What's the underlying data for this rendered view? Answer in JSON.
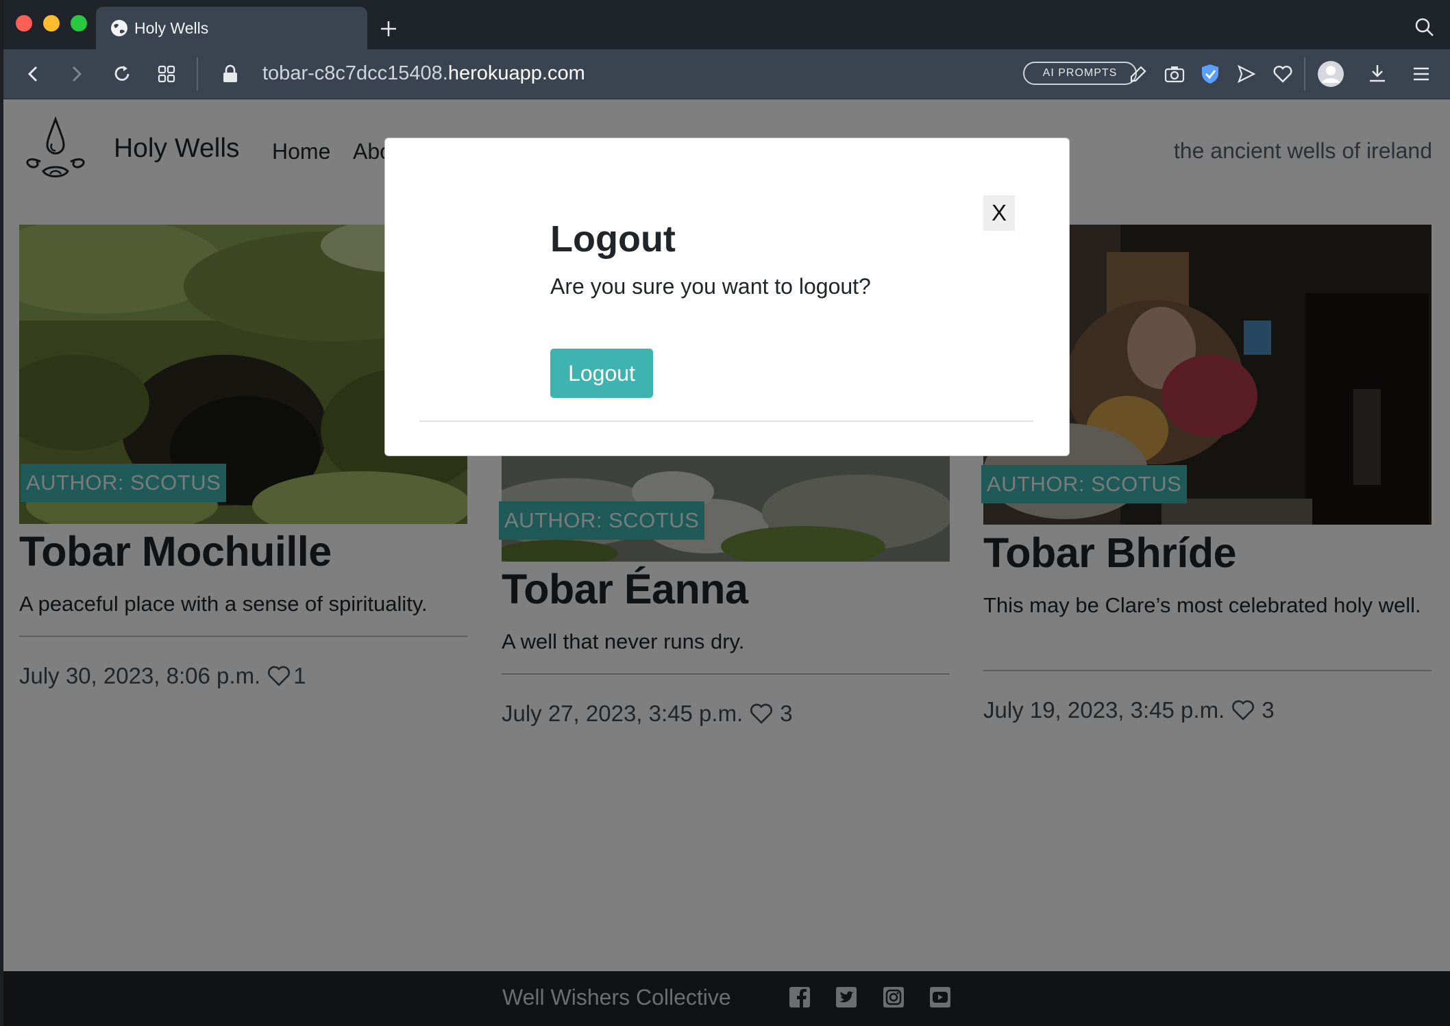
{
  "browser": {
    "tab_title": "Holy Wells",
    "url_prefix": "tobar-c8c7dcc15408.",
    "url_host": "herokuapp.com",
    "ai_prompts_label": "AI PROMPTS"
  },
  "site": {
    "brand": "Holy Wells",
    "nav": {
      "home": "Home",
      "about_partial": "Abo"
    },
    "tagline": "the ancient wells of ireland"
  },
  "cards": [
    {
      "author": "AUTHOR: SCOTUS",
      "title": "Tobar Mochuille",
      "excerpt": "A peaceful place with a sense of spirituality.",
      "date": "July 30, 2023, 8:06 p.m.",
      "likes": "1"
    },
    {
      "author": "AUTHOR: SCOTUS",
      "title": "Tobar Éanna",
      "excerpt": "A well that never runs dry.",
      "date": "July 27, 2023, 3:45 p.m.",
      "likes": "3"
    },
    {
      "author": "AUTHOR: SCOTUS",
      "title": "Tobar Bhríde",
      "excerpt": "This may be Clare’s most celebrated holy well.",
      "date": "July 19, 2023, 3:45 p.m.",
      "likes": "3"
    }
  ],
  "footer": {
    "text": "Well Wishers Collective"
  },
  "modal": {
    "close_label": "X",
    "title": "Logout",
    "body": "Are you sure you want to logout?",
    "button_label": "Logout"
  },
  "colors": {
    "accent": "#3fb3b0",
    "footer_bg": "#212529",
    "toolbar_bg": "#3a4350"
  }
}
